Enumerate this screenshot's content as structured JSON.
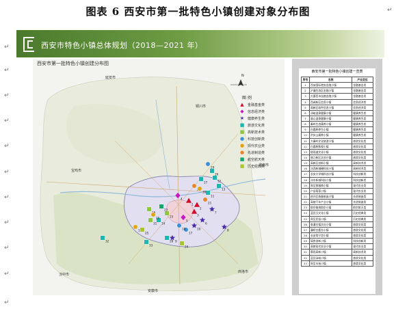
{
  "caption": "图表 6   西安市第一批特色小镇创建对象分布图",
  "paragraph_mark": "↵",
  "banner": {
    "title": "西安市特色小镇总体规划（2018—2021 年）"
  },
  "map": {
    "title": "西安市第一批特色小镇创建分布图",
    "legend_title": "图   例",
    "legend": [
      {
        "label": "金融基金类",
        "icon": "triangle",
        "color": "#d0102a"
      },
      {
        "label": "信息经济类",
        "icon": "diamond",
        "color": "#c21bbf"
      },
      {
        "label": "健康养生类",
        "icon": "star",
        "color": "#4b2ea8"
      },
      {
        "label": "旅游文化类",
        "icon": "square",
        "color": "#19b7b0"
      },
      {
        "label": "高新技术类",
        "icon": "square",
        "color": "#8dc63f"
      },
      {
        "label": "科技创新类",
        "icon": "circle",
        "color": "#3a8fd6"
      },
      {
        "label": "现代农业类",
        "icon": "circle",
        "color": "#e0a313"
      },
      {
        "label": "先进制造类",
        "icon": "circle",
        "color": "#e6852b"
      },
      {
        "label": "航空航天类",
        "icon": "square",
        "color": "#15a66b"
      },
      {
        "label": "历史经典类",
        "icon": "square",
        "color": "#a9c62e"
      }
    ],
    "places": [
      "延安市",
      "铜川市",
      "渭南市",
      "宝鸡市",
      "商洛市",
      "安康市",
      "汉中市"
    ],
    "north_label": "N",
    "markers": [
      {
        "type": "triangle",
        "color": "#d0102a",
        "label": "1"
      },
      {
        "type": "triangle",
        "color": "#d0102a",
        "label": "2"
      },
      {
        "type": "triangle",
        "color": "#d0102a",
        "label": "3"
      },
      {
        "type": "diamond",
        "color": "#c21bbf",
        "label": "4"
      },
      {
        "type": "diamond",
        "color": "#c21bbf",
        "label": "5"
      },
      {
        "type": "star",
        "color": "#4b2ea8",
        "label": "6"
      },
      {
        "type": "star",
        "color": "#4b2ea8",
        "label": "7"
      },
      {
        "type": "star",
        "color": "#4b2ea8",
        "label": "8"
      },
      {
        "type": "star",
        "color": "#4b2ea8",
        "label": "9"
      },
      {
        "type": "star",
        "color": "#4b2ea8",
        "label": "10"
      },
      {
        "type": "square",
        "color": "#19b7b0",
        "label": "11"
      },
      {
        "type": "square",
        "color": "#19b7b0",
        "label": "12"
      },
      {
        "type": "square",
        "color": "#19b7b0",
        "label": "13"
      },
      {
        "type": "square",
        "color": "#19b7b0",
        "label": "14"
      },
      {
        "type": "square",
        "color": "#8dc63f",
        "label": "15"
      },
      {
        "type": "square",
        "color": "#8dc63f",
        "label": "16"
      },
      {
        "type": "circle",
        "color": "#3a8fd6",
        "label": "17"
      },
      {
        "type": "circle",
        "color": "#3a8fd6",
        "label": "18"
      },
      {
        "type": "circle",
        "color": "#e0a313",
        "label": "19"
      },
      {
        "type": "circle",
        "color": "#e0a313",
        "label": "20"
      },
      {
        "type": "circle",
        "color": "#e6852b",
        "label": "21"
      },
      {
        "type": "circle",
        "color": "#e6852b",
        "label": "22"
      },
      {
        "type": "square",
        "color": "#15a66b",
        "label": "23"
      },
      {
        "type": "square",
        "color": "#a9c62e",
        "label": "24"
      },
      {
        "type": "square",
        "color": "#a9c62e",
        "label": "25"
      },
      {
        "type": "square",
        "color": "#19b7b0",
        "label": "26"
      },
      {
        "type": "square",
        "color": "#19b7b0",
        "label": "27"
      },
      {
        "type": "square",
        "color": "#19b7b0",
        "label": "28"
      },
      {
        "type": "circle",
        "color": "#3a8fd6",
        "label": "29"
      },
      {
        "type": "circle",
        "color": "#e0a313",
        "label": "30"
      },
      {
        "type": "square",
        "color": "#8dc63f",
        "label": "31"
      },
      {
        "type": "square",
        "color": "#19b7b0",
        "label": "32"
      },
      {
        "type": "square",
        "color": "#19b7b0",
        "label": "33"
      }
    ]
  },
  "table": {
    "title": "西安市第一批特色小镇创建一览表",
    "headers": [
      "序号",
      "名称",
      "产业定位"
    ],
    "rows": [
      [
        "1",
        "西安国际港务金融小镇",
        "金融基金类"
      ],
      [
        "2",
        "浐灞生态区金融小镇",
        "金融基金类"
      ],
      [
        "3",
        "大唐西市丝路金融小镇",
        "金融基金类"
      ],
      [
        "4",
        "西咸新区信息小镇",
        "信息经济类"
      ],
      [
        "5",
        "高新区软件信息小镇",
        "信息经济类"
      ],
      [
        "6",
        "汤峪温泉健康小镇",
        "健康养生类"
      ],
      [
        "7",
        "骊山温泉健康小镇",
        "健康养生类"
      ],
      [
        "8",
        "秦岭生态康养小镇",
        "健康养生类"
      ],
      [
        "9",
        "白鹿原养生小镇",
        "健康养生类"
      ],
      [
        "10",
        "洪庆山康养小镇",
        "健康养生类"
      ],
      [
        "11",
        "大秦岭文化旅游小镇",
        "旅游文化类"
      ],
      [
        "12",
        "白鹿原影视小镇",
        "旅游文化类"
      ],
      [
        "13",
        "楼观道文化小镇",
        "旅游文化类"
      ],
      [
        "14",
        "曲江新区文创小镇",
        "旅游文化类"
      ],
      [
        "15",
        "高新区创新小镇",
        "高新技术类"
      ],
      [
        "16",
        "沣西新城硬科技小镇",
        "高新技术类"
      ],
      [
        "17",
        "长安大学城科创小镇",
        "科技创新类"
      ],
      [
        "18",
        "沣东新城科技小镇",
        "科技创新类"
      ],
      [
        "19",
        "周至猕猴桃小镇",
        "现代农业类"
      ],
      [
        "20",
        "户县葡萄小镇",
        "现代农业类"
      ],
      [
        "21",
        "经开区装备制造小镇",
        "先进制造类"
      ],
      [
        "22",
        "高陵汽车产业小镇",
        "先进制造类"
      ],
      [
        "23",
        "航空基地航空小镇",
        "航空航天类"
      ],
      [
        "24",
        "蓝田玉文化小镇",
        "历史经典类"
      ],
      [
        "25",
        "周至民俗小镇",
        "历史经典类"
      ],
      [
        "26",
        "临潼古镇文化小镇",
        "旅游文化类"
      ],
      [
        "27",
        "灞桥白鹿仓小镇",
        "旅游文化类"
      ],
      [
        "28",
        "长安常宁宫小镇",
        "旅游文化类"
      ],
      [
        "29",
        "阎良创新小镇",
        "科技创新类"
      ],
      [
        "30",
        "高陵现代农业小镇",
        "现代农业类"
      ],
      [
        "31",
        "鄠邑高新小镇",
        "高新技术类"
      ],
      [
        "32",
        "蓝田汤峪小镇",
        "旅游文化类"
      ],
      [
        "33",
        "周至水街小镇",
        "旅游文化类"
      ]
    ]
  }
}
